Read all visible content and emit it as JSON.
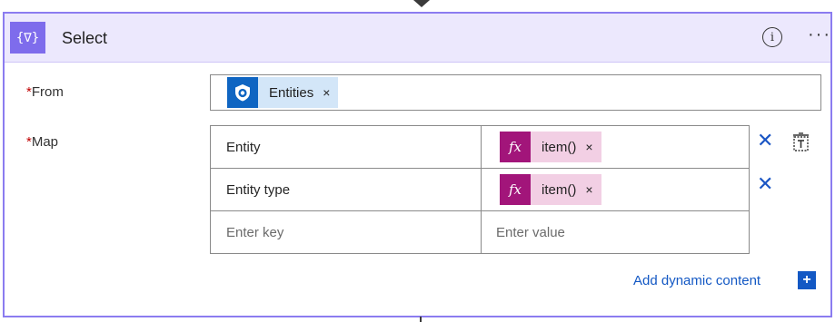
{
  "action": {
    "title": "Select",
    "header_icon_glyph": "{∇}",
    "info_glyph": "i",
    "more_glyph": "···"
  },
  "from": {
    "required_mark": "*",
    "label": "From",
    "token": {
      "text": "Entities",
      "remove": "×",
      "icon": "sentinel-shield-icon"
    }
  },
  "map": {
    "required_mark": "*",
    "label": "Map",
    "rows": [
      {
        "key": "Entity",
        "value_token": {
          "fx": "fx",
          "text": "item()",
          "remove": "×"
        },
        "delete": "✕"
      },
      {
        "key": "Entity type",
        "value_token": {
          "fx": "fx",
          "text": "item()",
          "remove": "×"
        },
        "delete": "✕"
      }
    ],
    "empty_row": {
      "key_placeholder": "Enter key",
      "value_placeholder": "Enter value"
    },
    "text_mode_icon": "switch-to-text-mode-icon"
  },
  "footer": {
    "add_dynamic_label": "Add dynamic content",
    "add_glyph": "+"
  },
  "colors": {
    "accent": "#8b7cf0",
    "header_bg": "#ece8fd",
    "link": "#1358c4",
    "fx_token": "#a2157a"
  }
}
